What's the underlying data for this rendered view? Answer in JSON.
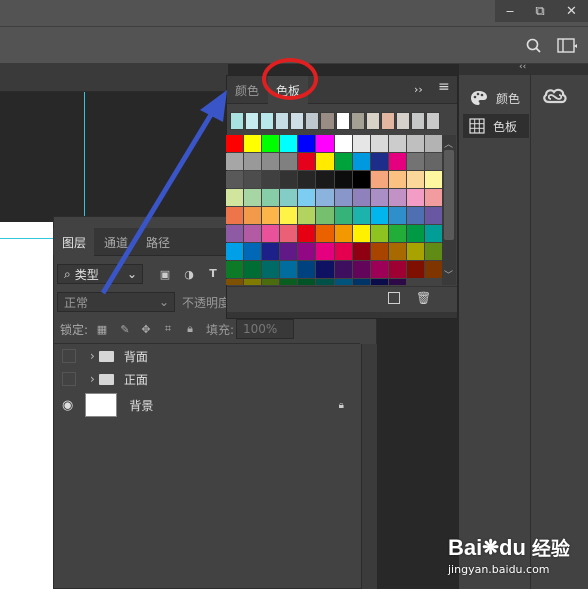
{
  "window": {
    "minimize": "‒",
    "restore": "⧉",
    "close": "✕"
  },
  "dock": {
    "color_label": "颜色",
    "swatches_label": "色板",
    "collapse": "‹‹"
  },
  "swatches_panel": {
    "tab_color": "颜色",
    "tab_swatches": "色板",
    "expand": "››",
    "menu": "≡",
    "recent_colors": [
      "#a9e3e1",
      "#c6ecf0",
      "#b9e8ec",
      "#c6dde6",
      "#cfdde6",
      "#bfc8ce",
      "#988c84",
      "#ffffff",
      "#a4a094",
      "#d9d3c7",
      "#e3b6a1",
      "#d5d0c9",
      "#c6c8c7",
      "#c9c9c9"
    ],
    "grid_colors": [
      "#ff0000",
      "#ffff00",
      "#00ff00",
      "#00ffff",
      "#0000ff",
      "#ff00ff",
      "#ffffff",
      "#e6e6e6",
      "#d9d9d9",
      "#cccccc",
      "#bfbfbf",
      "#b3b3b3",
      "#a6a6a6",
      "#999999",
      "#8c8c8c",
      "#808080",
      "#e5001b",
      "#ffea00",
      "#00a23c",
      "#0099e0",
      "#1c2d8a",
      "#e4007f",
      "#737373",
      "#666666",
      "#595959",
      "#4d4d4d",
      "#404040",
      "#333333",
      "#262626",
      "#1a1a1a",
      "#0d0d0d",
      "#000000",
      "#f7a77e",
      "#fbc182",
      "#fbd89a",
      "#fff7a0",
      "#d2e59f",
      "#a7d6a4",
      "#86cda8",
      "#84cdc6",
      "#7ccdf1",
      "#8bb3dd",
      "#8896c9",
      "#8f82bc",
      "#a98fc5",
      "#c291c6",
      "#f39cc5",
      "#f29c9f",
      "#ee7449",
      "#f39a4a",
      "#fbb549",
      "#fff348",
      "#b2d35f",
      "#75bf6f",
      "#35b379",
      "#1cb3ac",
      "#00b6ed",
      "#2e8fcb",
      "#4f6fb3",
      "#6a57a4",
      "#8e5aa3",
      "#b35aa4",
      "#e9529a",
      "#ec6075",
      "#e60012",
      "#eb6100",
      "#f39800",
      "#fff100",
      "#8fc31f",
      "#22ac38",
      "#009944",
      "#009e96",
      "#00a0e9",
      "#0068b7",
      "#1d2088",
      "#601986",
      "#920783",
      "#e4007f",
      "#e5004f",
      "#8f0012",
      "#a84300",
      "#a86a00",
      "#a8a300",
      "#608c15",
      "#0d7a28",
      "#006e34",
      "#006b66",
      "#006d9e",
      "#00427f",
      "#0f1263",
      "#3e0f5e",
      "#63055a",
      "#9c0057",
      "#9e0034",
      "#7f0f00",
      "#7e3500",
      "#7e5100",
      "#7f7b00",
      "#4b6b0f",
      "#0a5e1f",
      "#005426",
      "#005249",
      "#00537a",
      "#003366",
      "#0b0d4a",
      "#2d0a47"
    ]
  },
  "layers_panel": {
    "tab_layers": "图层",
    "tab_channels": "通道",
    "tab_paths": "路径",
    "filter_label": "类型",
    "blend_mode": "正常",
    "opacity_label": "不透明度",
    "lock_label": "锁定:",
    "fill_label": "填充:",
    "fill_value": "100%",
    "layers": [
      {
        "name": "背面",
        "kind": "folder",
        "visible": false
      },
      {
        "name": "正面",
        "kind": "folder",
        "visible": false
      },
      {
        "name": "背景",
        "kind": "image",
        "visible": true,
        "locked": true
      }
    ]
  },
  "watermark": {
    "brand": "Bai",
    "brand2": "du",
    "sub": "经验",
    "url": "jingyan.baidu.com"
  },
  "colors": {
    "annotation_ring": "#e02020",
    "arrow": "#3a55c8",
    "guide": "#33c7de"
  }
}
